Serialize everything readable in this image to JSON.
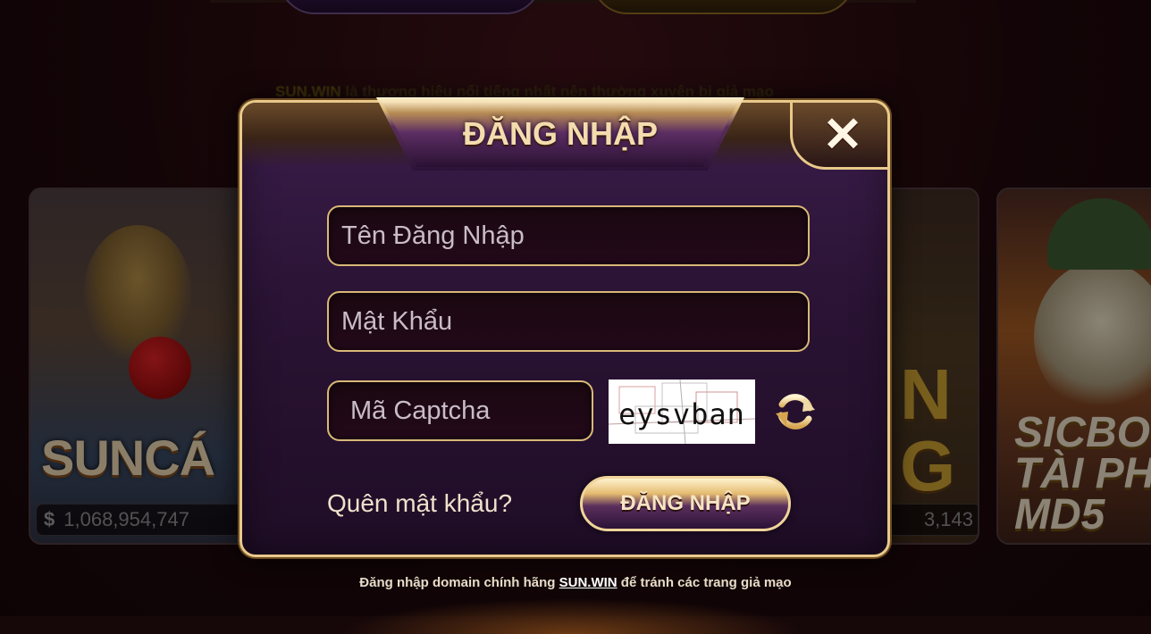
{
  "background_notice": {
    "brand": "SUN.WIN",
    "text": " là thương hiệu nổi tiếng nhất nên thường xuyên bị giả mạo"
  },
  "cards": [
    {
      "logo": "SUNCÁ",
      "currency_icon": "dollar-icon",
      "value": "1,068,954,747"
    },
    {
      "logo": "N\nG",
      "value": "3,143"
    },
    {
      "logo": "SICBO\nTÀI PH\nMD5"
    }
  ],
  "modal": {
    "title": "ĐĂNG NHẬP",
    "close_symbol": "✕",
    "username_placeholder": "Tên Đăng Nhập",
    "password_placeholder": "Mật Khẩu",
    "captcha_placeholder": "Mã Captcha",
    "captcha_text": "eysvban",
    "forgot_label": "Quên mật khẩu?",
    "login_button_label": "ĐĂNG NHẬP"
  },
  "footer": {
    "prefix": "Đăng nhập domain chính hãng ",
    "brand": "SUN.WIN",
    "suffix": " để tránh các trang giả mạo"
  },
  "colors": {
    "gold": "#e8c98a",
    "modal_purple": "#2a1334",
    "background": "#160709"
  }
}
